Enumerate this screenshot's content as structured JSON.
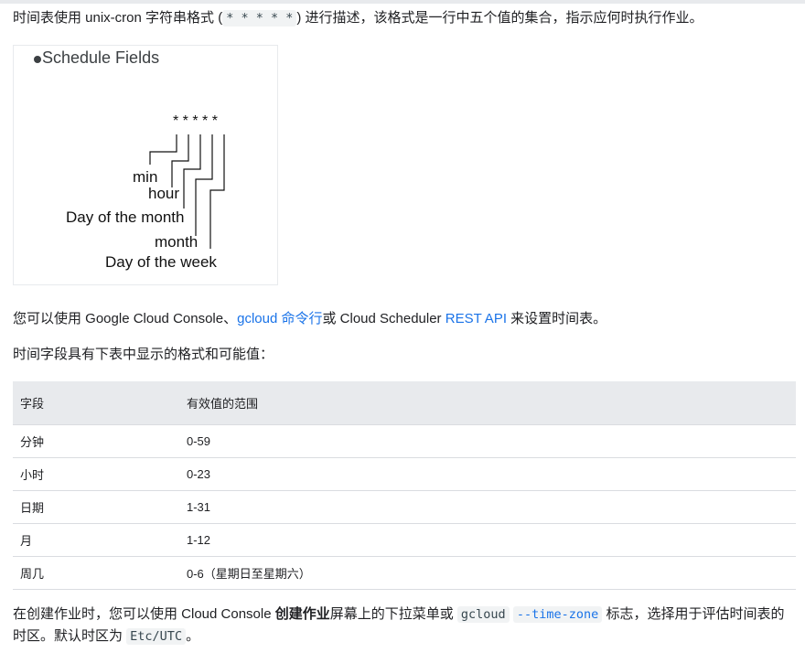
{
  "intro": {
    "before": "时间表使用 unix-cron 字符串格式 (",
    "code": "* * * * *",
    "after": ") 进行描述，该格式是一行中五个值的集合，指示应何时执行作业。"
  },
  "schedule_fields": {
    "title": "Schedule Fields",
    "stars": "* * * * *",
    "labels": {
      "min": "min",
      "hour": "hour",
      "day_of_month": "Day of the month",
      "month": "month",
      "day_of_week": "Day of the week"
    }
  },
  "setup": {
    "before": "您可以使用 Google Cloud Console、",
    "link1": "gcloud 命令行",
    "middle": "或 Cloud Scheduler ",
    "link2": "REST API",
    "after": " 来设置时间表。"
  },
  "table_intro": "时间字段具有下表中显示的格式和可能值：",
  "table": {
    "headers": [
      "字段",
      "有效值的范围"
    ],
    "rows": [
      [
        "分钟",
        "0-59"
      ],
      [
        "小时",
        "0-23"
      ],
      [
        "日期",
        "1-31"
      ],
      [
        "月",
        "1-12"
      ],
      [
        "周几",
        "0-6（星期日至星期六）"
      ]
    ]
  },
  "timezone": {
    "part1": "在创建作业时，您可以使用 Cloud Console ",
    "bold": "创建作业",
    "part2": "屏幕上的下拉菜单或 ",
    "code1": "gcloud",
    "space": " ",
    "code2": "--time-zone",
    "part3": " 标志，选择用于评估时间表的时区。默认时区为 ",
    "code3": "Etc/UTC",
    "part4": "。"
  }
}
